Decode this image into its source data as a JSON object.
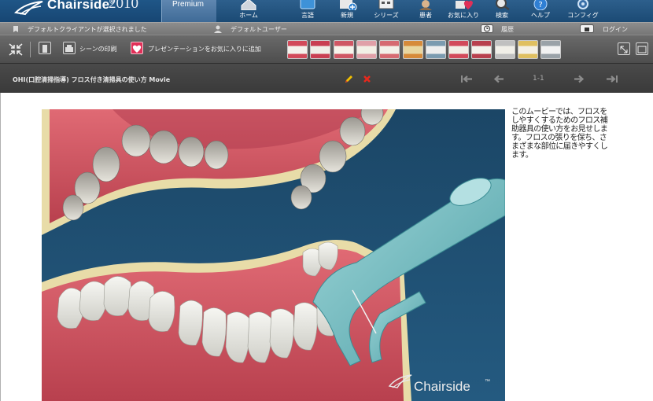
{
  "header": {
    "logo_name": "Chairside",
    "logo_reg": "®",
    "logo_year": "2010",
    "edition": "Premium",
    "nav": [
      {
        "label": "ホーム",
        "icon": "home-icon"
      },
      {
        "label": "言語",
        "icon": "language-icon"
      },
      {
        "label": "新規",
        "icon": "new-icon"
      },
      {
        "label": "シリーズ",
        "icon": "series-icon"
      },
      {
        "label": "患者",
        "icon": "patient-icon"
      },
      {
        "label": "お気に入り",
        "icon": "favorites-icon"
      },
      {
        "label": "検索",
        "icon": "search-icon"
      },
      {
        "label": "ヘルプ",
        "icon": "help-icon"
      },
      {
        "label": "コンフィグ",
        "icon": "config-icon"
      }
    ]
  },
  "status": {
    "client": "デフォルトクライアントが選択されました",
    "user": "デフォルトユーザー",
    "history": "履歴",
    "login": "ログイン"
  },
  "toolbar": {
    "print_label": "シーンの印刷",
    "favorite_label": "プレゼンテーションをお気に入りに追加",
    "thumbnail_count": 12
  },
  "scene": {
    "title": "OHI(口腔清掃指導) フロス付き清掃具の使い方 Movie",
    "pager": "1-1",
    "watermark": "Chairside",
    "watermark_tm": "™",
    "description": "このムービーでは、フロスをしやすくするためのフロス補助器具の使い方をお見せします。フロスの張りを保ち、さまざまな部位に届きやすくします。"
  },
  "colors": {
    "header_blue": "#1b4a74",
    "toolbar_gray": "#5a5a5a",
    "scene_background": "#1f4f73",
    "flosser_teal": "#7fc4c8",
    "gum_pink": "#d85a66"
  }
}
